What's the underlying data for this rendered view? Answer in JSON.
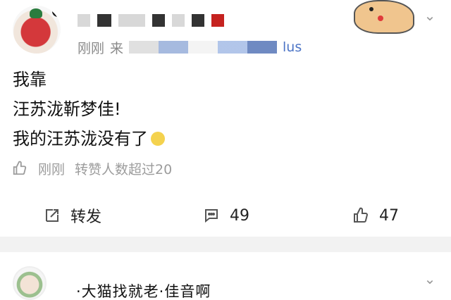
{
  "post": {
    "meta": {
      "time": "刚刚",
      "source_prefix": "来",
      "source_suffix": "lus"
    },
    "content": {
      "lines": [
        "我靠",
        "汪苏泷靳梦佳!",
        "我的汪苏泷没有了"
      ],
      "emoji_name": "sad-face-emoji"
    },
    "like_row": {
      "time": "刚刚",
      "text": "转赞人数超过20"
    },
    "actions": {
      "repost_label": "转发",
      "comment_count": "49",
      "like_count": "47"
    }
  },
  "next_post": {
    "visible_text": "·大猫找就老·佳音啊"
  },
  "colors": {
    "accent_blue": "#4c74c6",
    "muted_gray": "#9c9c9c",
    "separator": "#f2f2f2",
    "blur_red": "#c5221f"
  }
}
